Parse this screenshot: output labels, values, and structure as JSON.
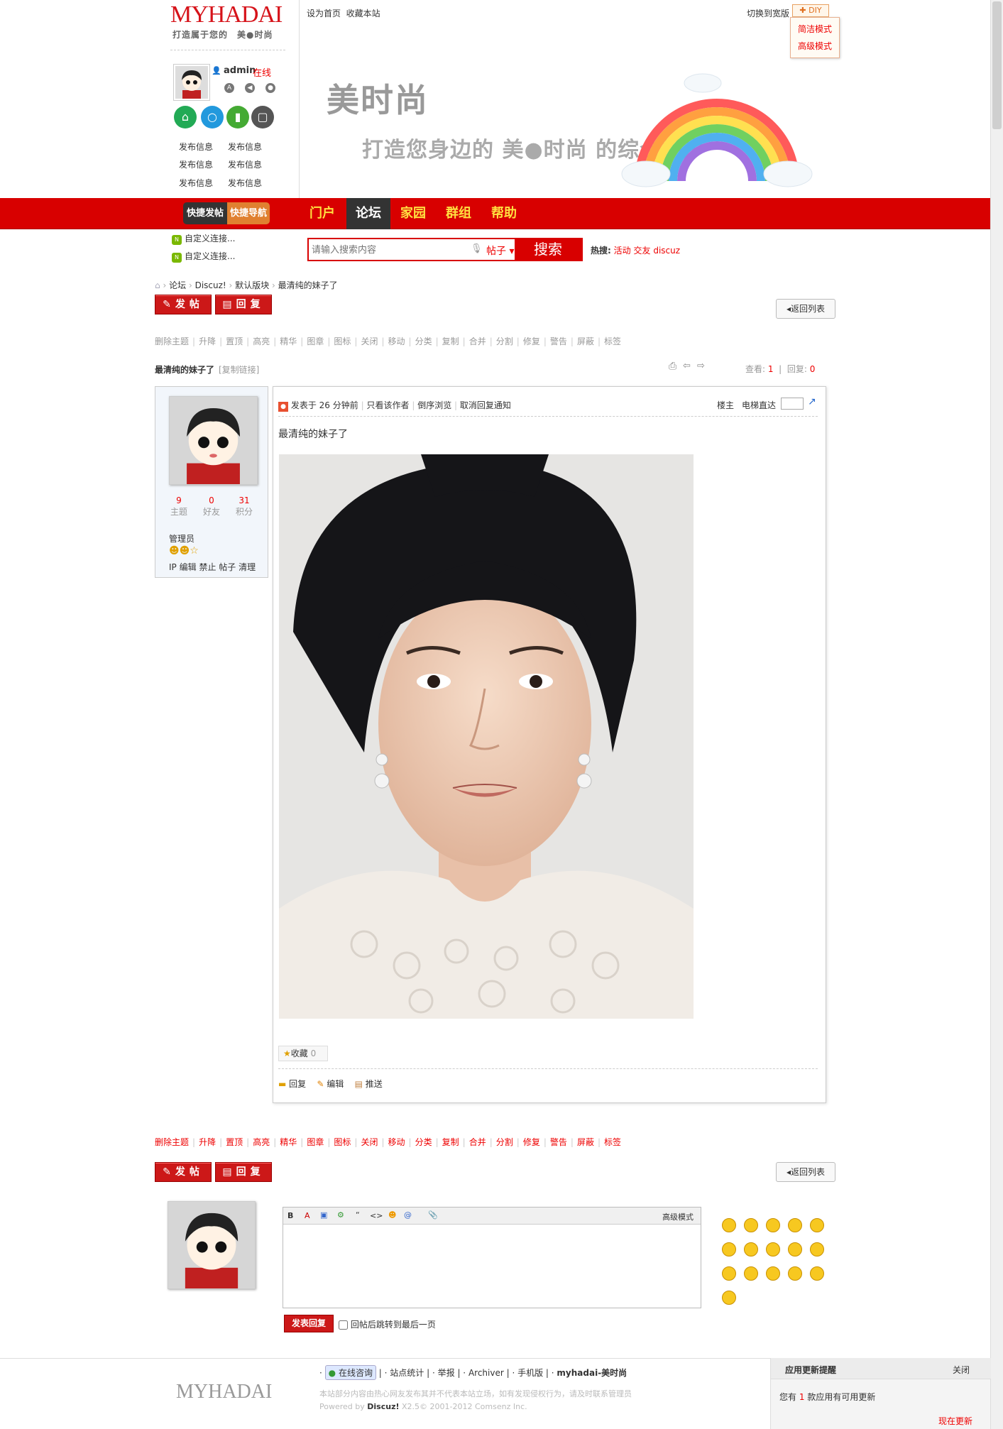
{
  "header": {
    "logo": "MYHADAI",
    "slogan": "打造属于您的　美●时尚",
    "user": {
      "name": "admin",
      "status": "在线"
    },
    "publish_links": [
      "发布信息",
      "发布信息",
      "发布信息",
      "发布信息",
      "发布信息",
      "发布信息"
    ],
    "top_links": [
      "设为首页",
      "收藏本站"
    ],
    "switch_style": "切换到宽版",
    "diy": "DIY",
    "modes": [
      "简洁模式",
      "高级模式"
    ],
    "banner_title": "美时尚",
    "banner_subtitle": "打造您身边的 美●时尚 的综合门户"
  },
  "nav": {
    "quick_post": "快捷发帖",
    "quick_nav": "快捷导航",
    "items": [
      "门户",
      "论坛",
      "家园",
      "群组",
      "帮助"
    ],
    "active": "论坛",
    "custom_links": [
      "自定义连接...",
      "自定义连接..."
    ]
  },
  "search": {
    "placeholder": "请输入搜索内容",
    "scope": "帖子",
    "button": "搜索",
    "hot_label": "热搜:",
    "hot_terms": [
      "活动",
      "交友",
      "discuz"
    ]
  },
  "breadcrumb": [
    "论坛",
    "Discuz!",
    "默认版块",
    "最清纯的妹子了"
  ],
  "buttons": {
    "post": "发帖",
    "reply": "回复",
    "back": "返回列表"
  },
  "mod_tools": [
    "删除主题",
    "升降",
    "置顶",
    "高亮",
    "精华",
    "图章",
    "图标",
    "关闭",
    "移动",
    "分类",
    "复制",
    "合并",
    "分割",
    "修复",
    "警告",
    "屏蔽",
    "标签"
  ],
  "thread": {
    "title": "最清纯的妹子了",
    "copy_link": "[复制链接]",
    "views_label": "查看:",
    "views": "1",
    "replies_label": "回复:",
    "replies": "0"
  },
  "author": {
    "stats": [
      {
        "n": "9",
        "l": "主题"
      },
      {
        "n": "0",
        "l": "好友"
      },
      {
        "n": "31",
        "l": "积分"
      }
    ],
    "group": "管理员",
    "admin_links": [
      "IP",
      "编辑",
      "禁止",
      "帖子",
      "清理"
    ]
  },
  "post": {
    "posted": "发表于",
    "time": "26 分钟前",
    "options": [
      "只看该作者",
      "倒序浏览",
      "取消回复通知"
    ],
    "floor": "楼主",
    "elevator": "电梯直达",
    "content": "最清纯的妹子了",
    "favorite": "收藏",
    "favorite_count": "0",
    "actions": [
      "回复",
      "编辑",
      "推送"
    ]
  },
  "editor": {
    "toolbar": [
      "B",
      "A",
      "▣",
      "⚙",
      "“",
      "<>",
      "☻",
      "@",
      "📎"
    ],
    "advanced": "高级模式",
    "submit": "发表回复",
    "jump_label": "回帖后跳转到最后一页"
  },
  "footer": {
    "logo": "MYHADAI",
    "consult": "在线咨询",
    "links": [
      "站点统计",
      "举报",
      "Archiver",
      "手机版",
      "myhadai-美时尚"
    ],
    "note1": "本站部分内容由热心网友发布其并不代表本站立场，如有发现侵权行为，请及时联系管理员",
    "note2_prefix": "Powered by",
    "note2_brand": "Discuz!",
    "note2_suffix": "X2.5© 2001-2012 Comsenz Inc.",
    "update_title": "应用更新提醒",
    "update_close": "关闭",
    "update_text_pre": "您有",
    "update_count": "1",
    "update_text_post": "款应用有可用更新",
    "update_now": "现在更新"
  },
  "colors": {
    "brand_red": "#d80000",
    "nav_text": "#ffe040",
    "link_red": "#e00"
  }
}
